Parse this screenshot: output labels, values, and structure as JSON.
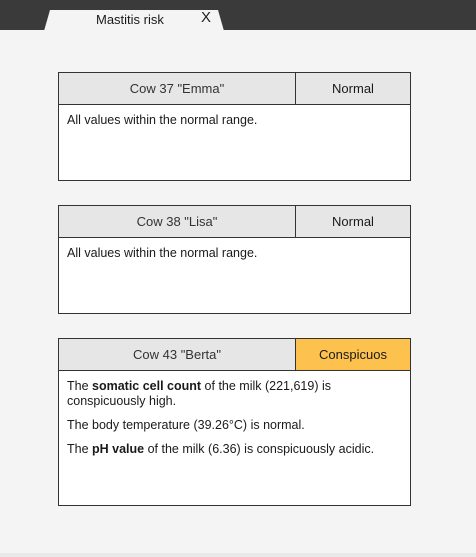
{
  "tab": {
    "title": "Mastitis risk",
    "close_glyph": "X"
  },
  "cards": [
    {
      "name": "Cow 37 \"Emma\"",
      "status": "Normal",
      "status_color": "#e6e6e6",
      "lines": [
        {
          "before": "All values within the normal range.",
          "bold": "",
          "after": ""
        }
      ]
    },
    {
      "name": "Cow 38 \"Lisa\"",
      "status": "Normal",
      "status_color": "#e6e6e6",
      "lines": [
        {
          "before": "All values within the normal range.",
          "bold": "",
          "after": ""
        }
      ]
    },
    {
      "name": "Cow 43 \"Berta\"",
      "status": "Conspicuos",
      "status_color": "#fdc24e",
      "lines": [
        {
          "before": "The ",
          "bold": "somatic cell count",
          "after": " of the milk (221,619) is conspicuously high."
        },
        {
          "before": "The body temperature (39.26°C) is normal.",
          "bold": "",
          "after": ""
        },
        {
          "before": "The ",
          "bold": "pH value",
          "after": " of the milk (6.36) is conspicuously acidic."
        }
      ]
    }
  ]
}
